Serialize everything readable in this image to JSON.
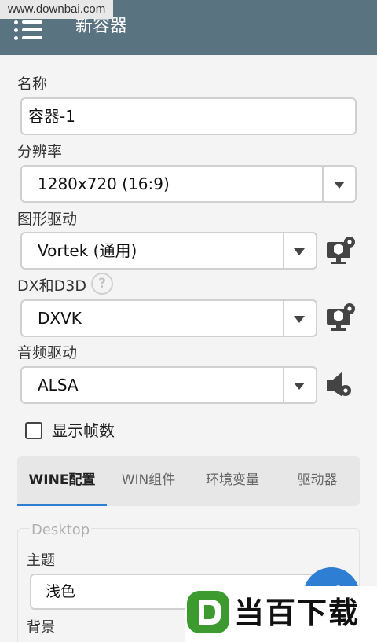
{
  "watermark": {
    "url": "www.downbai.com",
    "logo_text": "当百下载"
  },
  "app_bar": {
    "title": "新容器",
    "menu_icon": "hamburger-menu-icon"
  },
  "fields": {
    "name": {
      "label": "名称",
      "value": "容器-1"
    },
    "resolution": {
      "label": "分辨率",
      "value": "1280x720 (16:9)"
    },
    "graphics_driver": {
      "label": "图形驱动",
      "value": "Vortek (通用)"
    },
    "dx_d3d": {
      "label": "DX和D3D",
      "value": "DXVK",
      "help_icon": "?"
    },
    "audio_driver": {
      "label": "音频驱动",
      "value": "ALSA"
    }
  },
  "show_fps": {
    "label": "显示帧数",
    "checked": false
  },
  "tabs": [
    {
      "label": "WINE配置",
      "active": true
    },
    {
      "label": "WIN组件",
      "active": false
    },
    {
      "label": "环境变量",
      "active": false
    },
    {
      "label": "驱动器",
      "active": false
    }
  ],
  "desktop_panel": {
    "legend": "Desktop",
    "theme": {
      "label": "主题",
      "value": "浅色"
    },
    "background": {
      "label": "背景"
    }
  },
  "colors": {
    "app_bar": "#5a7381",
    "accent": "#2e7fd3",
    "background": "#f4f4f4"
  }
}
